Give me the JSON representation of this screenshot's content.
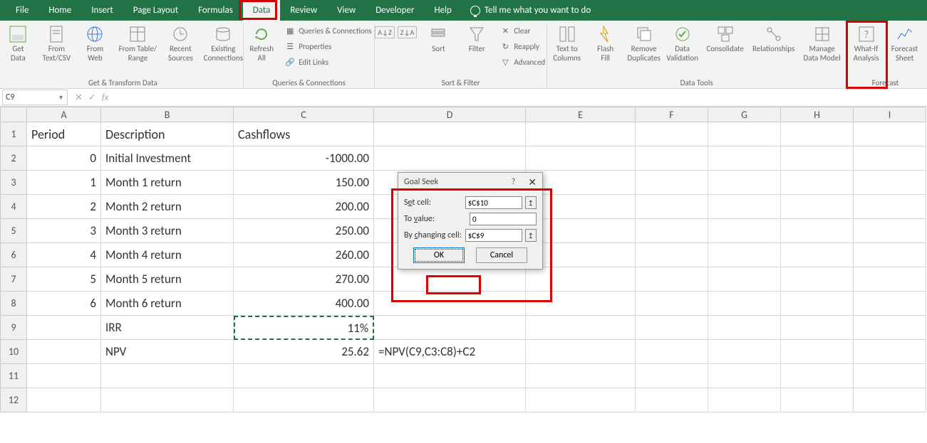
{
  "tabs": [
    "File",
    "Home",
    "Insert",
    "Page Layout",
    "Formulas",
    "Data",
    "Review",
    "View",
    "Developer",
    "Help"
  ],
  "active_tab": "Data",
  "tell_me": "Tell me what you want to do",
  "ribbon": {
    "group1": {
      "label": "Get & Transform Data",
      "btns": [
        "Get\nData",
        "From\nText/CSV",
        "From\nWeb",
        "From Table/\nRange",
        "Recent\nSources",
        "Existing\nConnections"
      ]
    },
    "group2": {
      "label": "Queries & Connections",
      "refresh": "Refresh\nAll",
      "items": [
        "Queries & Connections",
        "Properties",
        "Edit Links"
      ]
    },
    "group3": {
      "label": "Sort & Filter",
      "sort": "Sort",
      "filter": "Filter",
      "items": [
        "Clear",
        "Reapply",
        "Advanced"
      ]
    },
    "group4": {
      "label": "Data Tools",
      "btns": [
        "Text to\nColumns",
        "Flash\nFill",
        "Remove\nDuplicates",
        "Data\nValidation",
        "Consolidate",
        "Relationships",
        "Manage\nData Model"
      ]
    },
    "group5": {
      "label": "Forecast",
      "btns": [
        "What-If\nAnalysis",
        "Forecast\nSheet"
      ]
    }
  },
  "namebox": "C9",
  "formula": "",
  "columns": [
    "A",
    "B",
    "C",
    "D",
    "E",
    "F",
    "G",
    "H",
    "I"
  ],
  "rows": [
    "1",
    "2",
    "3",
    "4",
    "5",
    "6",
    "7",
    "8",
    "9",
    "10",
    "11",
    "12"
  ],
  "grid": {
    "A1": "Period",
    "B1": "Description",
    "C1": "Cashflows",
    "A2": "0",
    "B2": "Initial Investment",
    "C2": "-1000.00",
    "A3": "1",
    "B3": "Month 1 return",
    "C3": "150.00",
    "A4": "2",
    "B4": "Month 2 return",
    "C4": "200.00",
    "A5": "3",
    "B5": "Month 3 return",
    "C5": "250.00",
    "A6": "4",
    "B6": "Month 4 return",
    "C6": "260.00",
    "A7": "5",
    "B7": "Month 5 return",
    "C7": "270.00",
    "A8": "6",
    "B8": "Month 6 return",
    "C8": "400.00",
    "B9": "IRR",
    "C9": "11%",
    "B10": "NPV",
    "C10": "25.62",
    "D10": "=NPV(C9,C3:C8)+C2"
  },
  "dialog": {
    "title": "Goal Seek",
    "set_cell_label": "Set cell:",
    "set_cell": "$C$10",
    "to_value_label": "To value:",
    "to_value": "0",
    "changing_label": "By changing cell:",
    "changing": "$C$9",
    "ok": "OK",
    "cancel": "Cancel"
  }
}
